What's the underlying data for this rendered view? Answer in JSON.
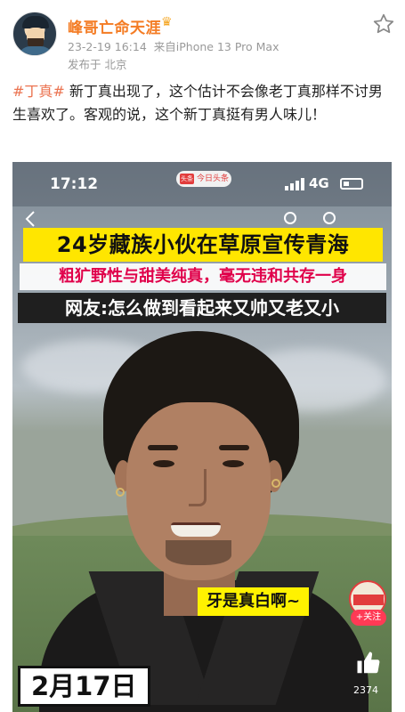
{
  "post": {
    "username": "峰哥亡命天涯",
    "timestamp": "23-2-19 16:14",
    "source": "来自iPhone 13 Pro Max",
    "location": "发布于 北京",
    "hashtag": "#丁真#",
    "body": " 新丁真出现了，这个估计不会像老丁真那样不讨男生喜欢了。客观的说，这个新丁真挺有男人味儿！"
  },
  "media": {
    "status_time": "17:12",
    "app_badge_icon": "头条",
    "app_badge": "今日头条",
    "network": "4G",
    "caption_line1": "24岁藏族小伙在草原宣传青海",
    "caption_line2": "粗犷野性与甜美纯真，毫无违和共存一身",
    "caption_line3": "网友:怎么做到看起来又帅又老又小",
    "subtitle": "牙是真白啊~",
    "follow_label": "+关注",
    "like_count": "2374",
    "date_stamp": "2月17日"
  },
  "colors": {
    "username": "#f47c24",
    "hashtag": "#eb7350",
    "caption_yellow": "#ffe600",
    "caption_pink": "#e0004a"
  }
}
